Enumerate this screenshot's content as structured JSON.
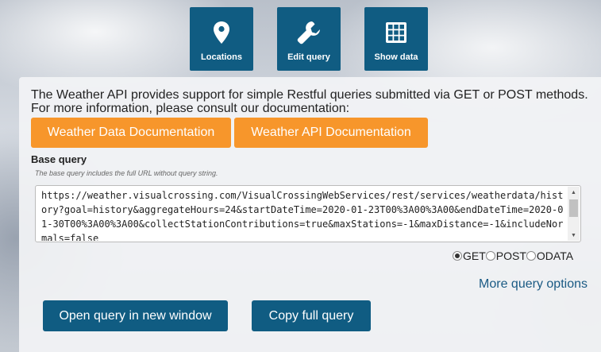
{
  "toolbar": {
    "locations": {
      "label": "Locations",
      "icon": "map-pin-icon"
    },
    "edit_query": {
      "label": "Edit query",
      "icon": "wrench-icon"
    },
    "show_data": {
      "label": "Show data",
      "icon": "grid-icon"
    },
    "color": "#105c82"
  },
  "intro": {
    "line1": "The Weather API provides support for simple Restful queries submitted via GET or POST methods.",
    "line2": "For more information, please consult our documentation:"
  },
  "docs": {
    "weather_data_label": "Weather Data Documentation",
    "weather_api_label": "Weather API Documentation",
    "color": "#f7962b"
  },
  "base_query": {
    "title": "Base query",
    "help": "The base query includes the full URL without query string.",
    "value": "https://weather.visualcrossing.com/VisualCrossingWebServices/rest/services/weatherdata/history?goal=history&aggregateHours=24&startDateTime=2020-01-23T00%3A00%3A00&endDateTime=2020-01-30T00%3A00%3A00&collectStationContributions=true&maxStations=-1&maxDistance=-1&includeNormals=false"
  },
  "methods": {
    "options": [
      "GET",
      "POST",
      "ODATA"
    ],
    "selected": "GET"
  },
  "more_options_label": "More query options",
  "actions": {
    "open_label": "Open query in new window",
    "copy_label": "Copy full query"
  }
}
